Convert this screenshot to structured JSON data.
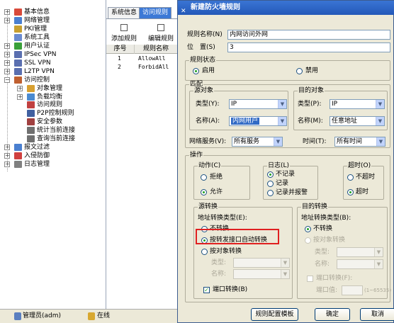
{
  "tree": {
    "items": [
      {
        "label": "基本信息",
        "expander": "+",
        "icon": "#d84a3a"
      },
      {
        "label": "网络管理",
        "expander": "+",
        "icon": "#4a7fd0"
      },
      {
        "label": "PKI管理",
        "expander": "",
        "icon": "#c8a030"
      },
      {
        "label": "系统工具",
        "expander": "",
        "icon": "#6a8bd0"
      },
      {
        "label": "用户认证",
        "expander": "+",
        "icon": "#3aa03a"
      },
      {
        "label": "IPSec VPN",
        "expander": "+",
        "icon": "#5a6fb0"
      },
      {
        "label": "SSL VPN",
        "expander": "+",
        "icon": "#5a6fb0"
      },
      {
        "label": "L2TP VPN",
        "expander": "+",
        "icon": "#5a6fb0"
      },
      {
        "label": "访问控制",
        "expander": "−",
        "icon": "#c06030"
      },
      {
        "label": "对象管理",
        "expander": "+",
        "icon": "#d8a030",
        "indent": 1
      },
      {
        "label": "负载均衡",
        "expander": "+",
        "icon": "#4a8ad0",
        "indent": 1
      },
      {
        "label": "访问规则",
        "expander": "",
        "icon": "#c04040",
        "indent": 1
      },
      {
        "label": "P2P控制规则",
        "expander": "",
        "icon": "#4060a0",
        "indent": 1
      },
      {
        "label": "安全参数",
        "expander": "",
        "icon": "#a04040",
        "indent": 1
      },
      {
        "label": "统计当前连接",
        "expander": "",
        "icon": "#707070",
        "indent": 1
      },
      {
        "label": "查询当前连接",
        "expander": "",
        "icon": "#707070",
        "indent": 1
      },
      {
        "label": "报文过滤",
        "expander": "+",
        "icon": "#4a7fd0"
      },
      {
        "label": "入侵防御",
        "expander": "+",
        "icon": "#d04040"
      },
      {
        "label": "日志管理",
        "expander": "+",
        "icon": "#808080"
      }
    ]
  },
  "mid": {
    "tabs": [
      "系统信息",
      "访问规则"
    ],
    "toolbar": {
      "add": "添加规则",
      "edit": "编辑规则"
    },
    "columns": [
      "序号",
      "规则名称"
    ],
    "rows": [
      {
        "no": "1",
        "name": "AllowAll"
      },
      {
        "no": "2",
        "name": "ForbidAll"
      }
    ]
  },
  "status": {
    "user": "管理员(adm)",
    "conn": "在线"
  },
  "dialog": {
    "title": "新建防火墙规则",
    "rule_name_label": "规则名称(N)",
    "rule_name_value": "内网访问外网",
    "position_label": "位　置(S)",
    "position_value": "3",
    "rule_state": {
      "title": "规则状态",
      "enable": "启用",
      "disable": "禁用"
    },
    "match": {
      "title": "匹配",
      "src": {
        "title": "源对象",
        "type_label": "类型(Y):",
        "type_value": "IP",
        "name_label": "名称(A):",
        "name_value": "内网用户"
      },
      "dst": {
        "title": "目的对象",
        "type_label": "类型(P):",
        "type_value": "IP",
        "name_label": "名称(M):",
        "name_value": "任意地址"
      },
      "service_label": "网络服务(V):",
      "service_value": "所有服务",
      "time_label": "时间(T):",
      "time_value": "所有时间"
    },
    "ops": {
      "title": "操作",
      "action": {
        "title": "动作(C)",
        "deny": "拒绝",
        "allow": "允许"
      },
      "log": {
        "title": "日志(L)",
        "none": "不记录",
        "log": "记录",
        "log_alert": "记录并报警"
      },
      "timeout": {
        "title": "超时(O)",
        "no_timeout": "不超时",
        "timeout": "超时"
      },
      "snat": {
        "title": "源转换",
        "type_label": "地址转换类型(E):",
        "none": "不转换",
        "auto": "按转发接口自动转换",
        "by_obj": "按对象转换",
        "type_field": "类型:",
        "name_field": "名称:",
        "port_conv": "端口转换(B)"
      },
      "dnat": {
        "title": "目的转换",
        "type_label": "地址转换类型(B):",
        "none": "不转换",
        "by_obj": "按对象转换",
        "type_field": "类型:",
        "name_field": "名称:",
        "port_conv": "端口转换(F):",
        "port_value_label": "端口值:",
        "port_range": "(1~65535)"
      }
    },
    "buttons": {
      "template": "规则配置模板",
      "ok": "确定",
      "cancel": "取消"
    }
  }
}
